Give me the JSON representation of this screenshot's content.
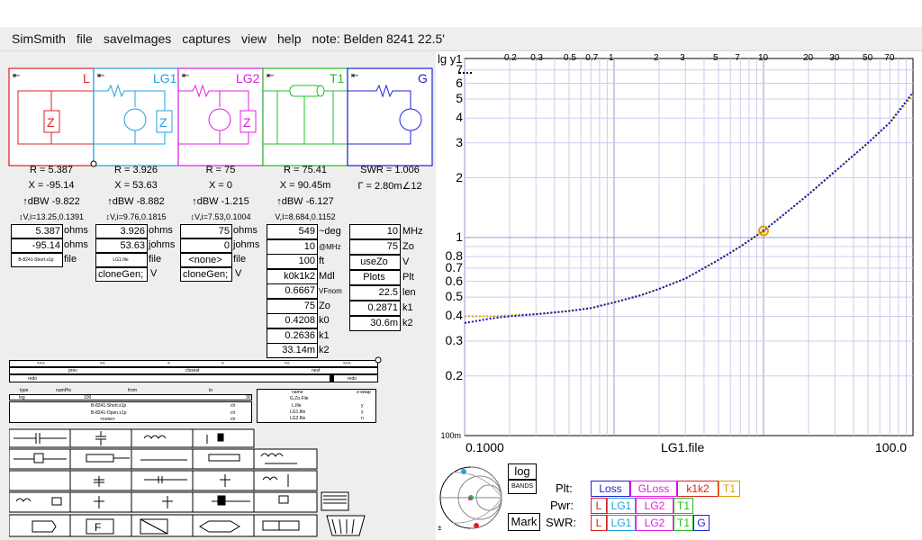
{
  "menu": [
    "SimSmith",
    "file",
    "saveImages",
    "captures",
    "view",
    "help",
    "note: Belden 8241 22.5'"
  ],
  "blocks": [
    {
      "id": "L",
      "label": "L",
      "color": "#e02020"
    },
    {
      "id": "LG1",
      "label": "LG1",
      "color": "#20a0e0"
    },
    {
      "id": "LG2",
      "label": "LG2",
      "color": "#e020e0"
    },
    {
      "id": "T1",
      "label": "T1",
      "color": "#20c020"
    },
    {
      "id": "G",
      "label": "G",
      "color": "#2020e0"
    }
  ],
  "readouts": {
    "L": {
      "r": "R = 5.387",
      "x": "X = -95.14",
      "dbw": "↑dBW -9.822",
      "vi": "↕V,i=13.25,0.1391"
    },
    "LG1": {
      "r": "R = 3.926",
      "x": "X = 53.63",
      "dbw": "↑dBW -8.882",
      "vi": "↕V,i=9.76,0.1815"
    },
    "LG2": {
      "r": "R = 75",
      "x": "X = 0",
      "dbw": "↑dBW -1.215",
      "vi": "↕V,i=7.53,0.1004"
    },
    "T1": {
      "r": "R = 75.41",
      "x": "X = 90.45m",
      "dbw": "↑dBW -6.127",
      "vi": "V,I=8.684,0.1152"
    },
    "G": {
      "swr": "SWR = 1.006",
      "gamma": "Γ = 2.80m∠12"
    }
  },
  "L_fields": {
    "r": "5.387",
    "r_unit": "ohms",
    "x": "-95.14",
    "x_unit": "ohms",
    "file": "B-8241-Short.s1p",
    "file_unit": "file"
  },
  "LG1_fields": {
    "r": "3.926",
    "r_unit": "ohms",
    "x": "53.63",
    "x_unit": "johms",
    "file": "LG1.file",
    "file_unit": "file",
    "clone": "cloneGen;",
    "clone_unit": "V"
  },
  "LG2_fields": {
    "r": "75",
    "r_unit": "ohms",
    "x": "0",
    "x_unit": "johms",
    "file": "<none>",
    "file_unit": "file",
    "clone": "cloneGen;",
    "clone_unit": "V"
  },
  "T1_fields": [
    {
      "v": "549",
      "u": "~deg"
    },
    {
      "v": "10",
      "u": "@MHz"
    },
    {
      "v": "100",
      "u": "ft"
    },
    {
      "v": "k0k1k2",
      "u": "Mdl"
    },
    {
      "v": "0.6667",
      "u": "VFnom"
    },
    {
      "v": "75",
      "u": "Zo"
    },
    {
      "v": "0.4208",
      "u": "k0"
    },
    {
      "v": "0.2636",
      "u": "k1"
    },
    {
      "v": "33.14m",
      "u": "k2"
    }
  ],
  "G_fields": [
    {
      "v": "10",
      "u": "MHz"
    },
    {
      "v": "75",
      "u": "Zo"
    },
    {
      "v": "useZo",
      "u": "V"
    },
    {
      "v": "Plots",
      "u": "Plt"
    },
    {
      "v": "22.5",
      "u": "len"
    },
    {
      "v": "0.2871",
      "u": "k1"
    },
    {
      "v": "30.6m",
      "u": "k2"
    }
  ],
  "sweep": {
    "row1": [
      "<<<",
      "<<",
      "<",
      "<",
      "<<",
      "<<<"
    ],
    "row2": [
      "prev",
      "closest",
      "next"
    ],
    "row3": [
      "redo",
      "redo"
    ]
  },
  "filetable": {
    "headers": [
      "type",
      "numPts",
      "from",
      "to"
    ],
    "row1": [
      "log",
      "100",
      "",
      "30"
    ],
    "files": [
      "B-8241-Short.s1p",
      "B-8241-Open.s1p",
      "<none>"
    ],
    "actions": [
      "clr",
      "clr",
      "clr"
    ],
    "right_headers": [
      "name",
      "z-swap"
    ],
    "right_rows": [
      [
        "G.Zo.File",
        ""
      ],
      [
        "L.file",
        "y"
      ],
      [
        "LG1.file",
        "y"
      ],
      [
        "LG2.file",
        "n"
      ]
    ]
  },
  "plot": {
    "y_axis_label": "lg y1",
    "x_axis_label": "LG1.file",
    "x_left": "0.1000",
    "x_right": "100.0",
    "y_bottom_label": "100m",
    "top_ticks": [
      "0.2",
      "0.3",
      "0.5",
      "0.7",
      "1",
      "2",
      "3",
      "5",
      "7",
      "10",
      "20",
      "30",
      "50",
      "70"
    ],
    "y_ticks": [
      "7",
      "6",
      "5",
      "4",
      "3",
      "2",
      "1",
      "0.8",
      "0.7",
      "0.6",
      "0.5",
      "0.4",
      "0.3",
      "0.2"
    ],
    "marker_x": 10,
    "marker_y": 1.08
  },
  "chart_data": {
    "type": "line",
    "xscale": "log",
    "yscale": "log",
    "xlim": [
      0.1,
      100
    ],
    "ylim": [
      0.1,
      8
    ],
    "x": [
      0.1,
      0.15,
      0.2,
      0.3,
      0.5,
      0.7,
      1,
      1.5,
      2,
      3,
      5,
      7,
      10,
      15,
      20,
      30,
      50,
      70,
      100
    ],
    "series": [
      {
        "color": "#f0b000",
        "values": [
          0.4,
          0.4,
          0.405,
          0.41,
          0.425,
          0.44,
          0.47,
          0.51,
          0.55,
          0.62,
          0.77,
          0.9,
          1.08,
          1.38,
          1.65,
          2.15,
          3.0,
          3.8,
          5.2
        ]
      },
      {
        "color": "#1010c0",
        "values": [
          0.37,
          0.39,
          0.4,
          0.41,
          0.425,
          0.44,
          0.47,
          0.51,
          0.55,
          0.62,
          0.77,
          0.9,
          1.08,
          1.38,
          1.65,
          2.15,
          3.0,
          3.8,
          5.4
        ]
      }
    ]
  },
  "bottom": {
    "log_btn": "log",
    "bands_btn": "BANDS",
    "mark_btn": "Mark",
    "plt_label": "Plt:",
    "pwr_label": "Pwr:",
    "swr_label": "SWR:",
    "plt_buttons": [
      {
        "label": "Loss",
        "color": "#2020e0"
      },
      {
        "label": "GLoss",
        "color": "#e020e0"
      },
      {
        "label": "k1k2",
        "color": "#e02020"
      },
      {
        "label": "T1",
        "color": "#e0a000"
      }
    ],
    "pwr_buttons": [
      {
        "label": "L",
        "color": "#e02020"
      },
      {
        "label": "LG1",
        "color": "#20a0e0"
      },
      {
        "label": "LG2",
        "color": "#e020e0"
      },
      {
        "label": "T1",
        "color": "#20c020"
      }
    ],
    "swr_buttons": [
      {
        "label": "L",
        "color": "#e02020"
      },
      {
        "label": "LG1",
        "color": "#20a0e0"
      },
      {
        "label": "LG2",
        "color": "#e020e0"
      },
      {
        "label": "T1",
        "color": "#20c020"
      },
      {
        "label": "G",
        "color": "#2020e0"
      }
    ]
  }
}
